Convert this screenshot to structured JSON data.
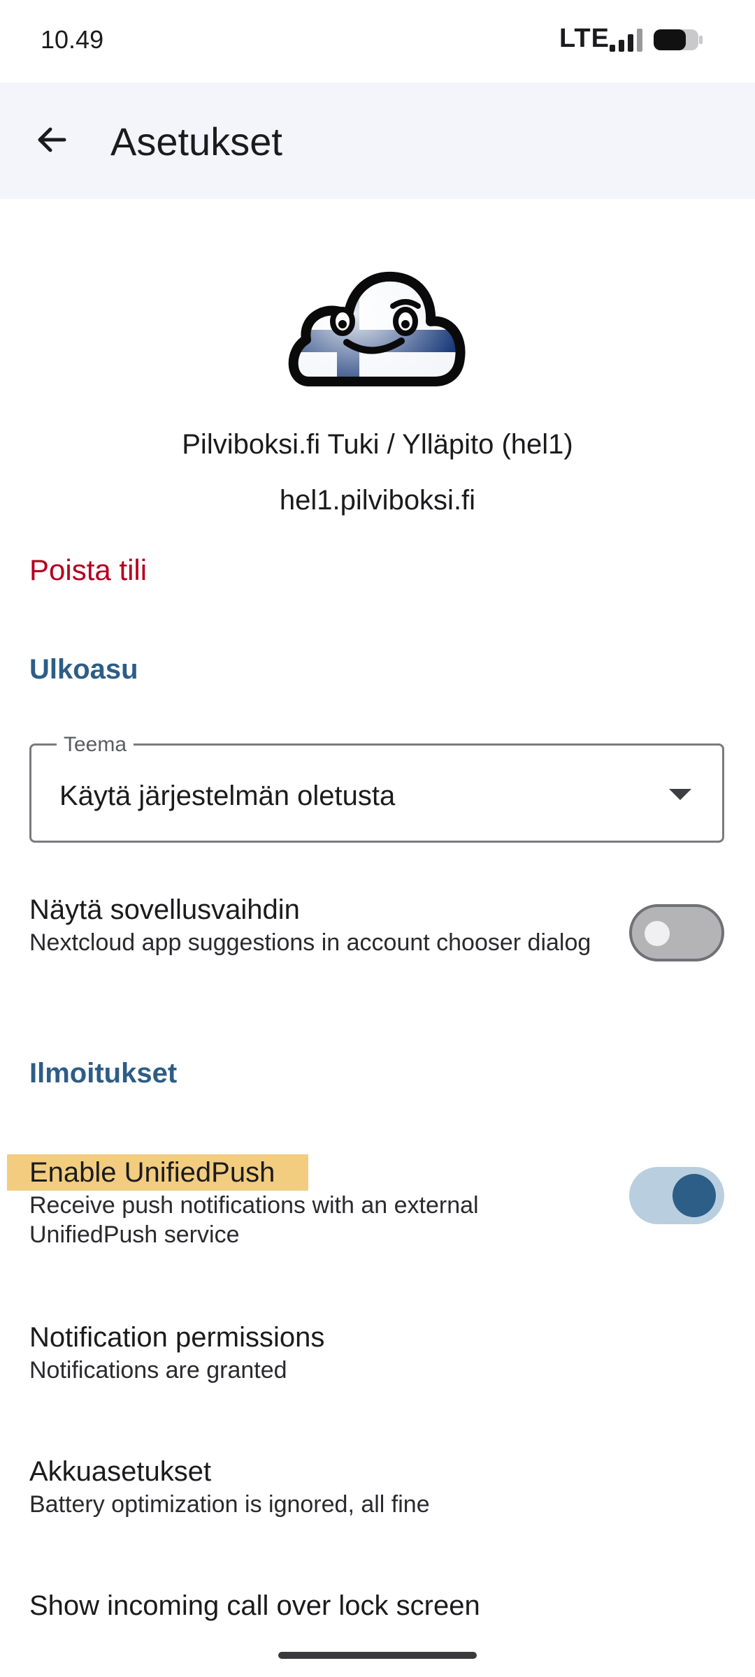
{
  "status_bar": {
    "time": "10.49",
    "network": "LTE"
  },
  "app_bar": {
    "title": "Asetukset"
  },
  "account": {
    "name": "Pilviboksi.fi Tuki / Ylläpito (hel1)",
    "server": "hel1.pilviboksi.fi",
    "delete_label": "Poista tili"
  },
  "appearance": {
    "header": "Ulkoasu",
    "theme": {
      "label": "Teema",
      "value": "Käytä järjestelmän oletusta"
    },
    "app_switcher": {
      "title": "Näytä sovellusvaihdin",
      "summary": "Nextcloud app suggestions in account chooser dialog",
      "enabled": false
    }
  },
  "notifications": {
    "header": "Ilmoitukset",
    "unified_push": {
      "title": "Enable UnifiedPush",
      "summary": "Receive push notifications with an external UnifiedPush service",
      "enabled": true
    },
    "permissions": {
      "title": "Notification permissions",
      "summary": "Notifications are granted"
    },
    "battery": {
      "title": "Akkuasetukset",
      "summary": "Battery optimization is ignored, all fine"
    },
    "lock_screen": {
      "title": "Show incoming call over lock screen"
    }
  },
  "colors": {
    "accent": "#2d5d86",
    "danger": "#b3001e",
    "highlight": "#f2cd80",
    "app_bar": "#f3f5fb"
  }
}
